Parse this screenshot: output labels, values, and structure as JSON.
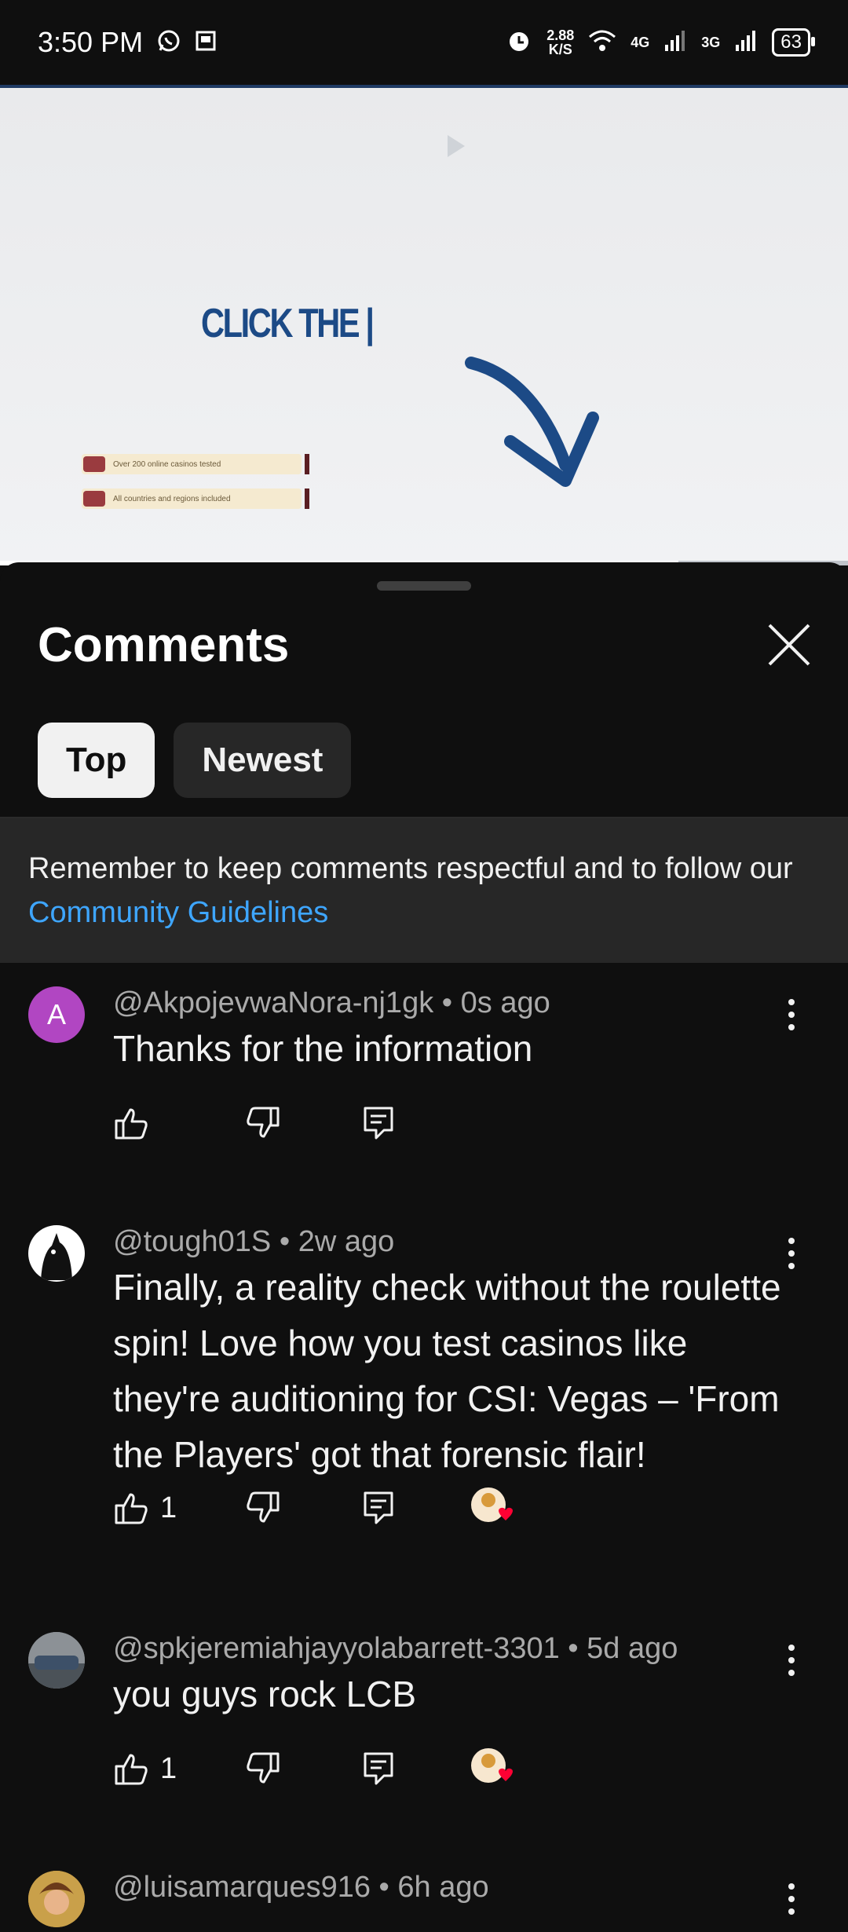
{
  "status_bar": {
    "time": "3:50 PM",
    "net_speed_value": "2.88",
    "net_speed_unit": "K/S",
    "sim1": "4G",
    "sim2": "3G",
    "battery": "63"
  },
  "video": {
    "overlay_text": "CLICK THE |",
    "chip1": "Over 200 online casinos tested",
    "chip2": "All countries and regions included",
    "progress_fraction": 0.8
  },
  "sheet": {
    "title": "Comments",
    "tabs": [
      {
        "label": "Top",
        "active": true
      },
      {
        "label": "Newest",
        "active": false
      }
    ],
    "notice_text": "Remember to keep comments respectful and to follow our ",
    "notice_link": "Community Guidelines"
  },
  "comments": [
    {
      "author": "@AkpojevwaNora-nj1gk",
      "time": "0s ago",
      "text": "Thanks for the information",
      "likes": "",
      "avatar_letter": "A",
      "avatar_color": "#b146c2",
      "creator_heart": false
    },
    {
      "author": "@tough01S",
      "time": "2w ago",
      "text": "Finally, a reality check without the roulette spin! Love how you test casinos like they're auditioning for CSI: Vegas – 'From the Players' got that forensic flair!",
      "likes": "1",
      "creator_heart": true
    },
    {
      "author": "@spkjeremiahjayyolabarrett-3301",
      "time": "5d ago",
      "text": "you guys rock LCB",
      "likes": "1",
      "creator_heart": true
    },
    {
      "author": "@luisamarques916",
      "time": "6h ago",
      "text": "",
      "likes": "",
      "creator_heart": false
    }
  ],
  "colors": {
    "background": "#0f0f0f",
    "link": "#3ea6ff",
    "heart": "#ff0033",
    "secondary_text": "#aaaaaa"
  }
}
